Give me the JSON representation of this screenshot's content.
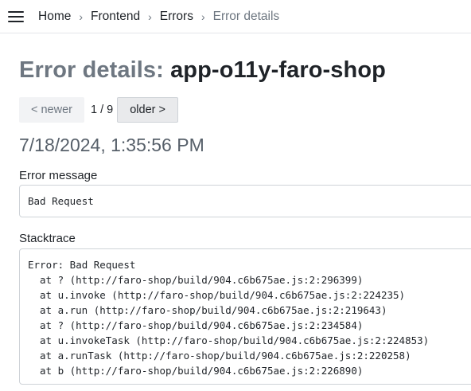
{
  "breadcrumb": {
    "items": [
      "Home",
      "Frontend",
      "Errors"
    ],
    "current": "Error details"
  },
  "header": {
    "title_prefix": "Error details:",
    "app_name": "app-o11y-faro-shop"
  },
  "pager": {
    "newer_label": "< newer",
    "position": "1 / 9",
    "older_label": "older >"
  },
  "timestamp": "7/18/2024, 1:35:56 PM",
  "error_message": {
    "label": "Error message",
    "value": "Bad Request"
  },
  "stacktrace": {
    "label": "Stacktrace",
    "header": "Error: Bad Request",
    "frames": [
      "at ? (http://faro-shop/build/904.c6b675ae.js:2:296399)",
      "at u.invoke (http://faro-shop/build/904.c6b675ae.js:2:224235)",
      "at a.run (http://faro-shop/build/904.c6b675ae.js:2:219643)",
      "at ? (http://faro-shop/build/904.c6b675ae.js:2:234584)",
      "at u.invokeTask (http://faro-shop/build/904.c6b675ae.js:2:224853)",
      "at a.runTask (http://faro-shop/build/904.c6b675ae.js:2:220258)",
      "at b (http://faro-shop/build/904.c6b675ae.js:2:226890)"
    ]
  },
  "icons": {
    "menu": "hamburger-menu-icon",
    "separator": "chevron-right-icon"
  }
}
